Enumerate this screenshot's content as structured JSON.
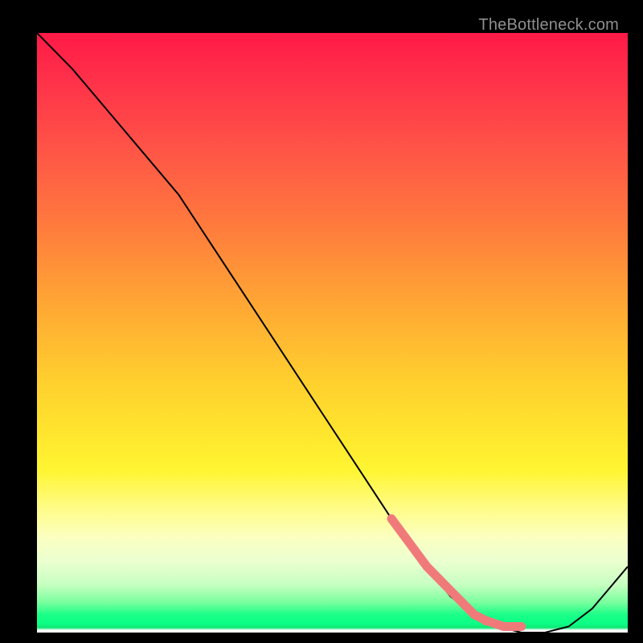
{
  "watermark": "TheBottleneck.com",
  "chart_data": {
    "type": "line",
    "title": "",
    "xlabel": "",
    "ylabel": "",
    "xlim": [
      0,
      100
    ],
    "ylim": [
      0,
      100
    ],
    "series": [
      {
        "name": "curve",
        "x": [
          0,
          6,
          12,
          18,
          24,
          30,
          36,
          42,
          48,
          54,
          60,
          66,
          70,
          74,
          78,
          82,
          86,
          90,
          94,
          100
        ],
        "y": [
          100,
          94,
          87,
          80,
          73,
          64,
          55,
          46,
          37,
          28,
          19,
          11,
          6,
          3,
          1,
          0,
          0,
          1,
          4,
          11
        ]
      }
    ],
    "highlight": {
      "name": "marker-cluster",
      "color": "#f07a7a",
      "points_x": [
        60,
        63,
        66,
        69,
        72,
        74,
        76,
        79,
        82
      ],
      "points_y": [
        19,
        15,
        11,
        8,
        5,
        3,
        2,
        1,
        1
      ]
    }
  }
}
